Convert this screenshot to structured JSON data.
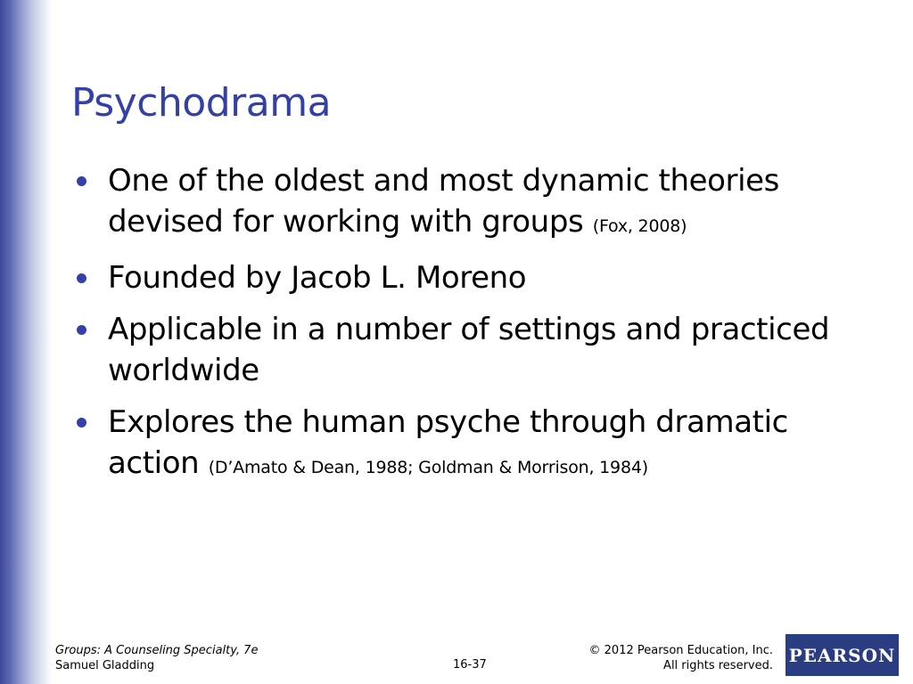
{
  "slide": {
    "title": "Psychodrama",
    "bullets": [
      {
        "text": "One of the oldest and most dynamic theories devised for working with groups",
        "citation": "(Fox, 2008)"
      },
      {
        "text": "Founded by Jacob L. Moreno",
        "citation": ""
      },
      {
        "text": "Applicable in a number of settings and practiced worldwide",
        "citation": ""
      },
      {
        "text": "Explores the human psyche through dramatic action",
        "citation": "(D’Amato & Dean, 1988; Goldman & Morrison, 1984)"
      }
    ]
  },
  "footer": {
    "book_title": "Groups: A Counseling Specialty, 7e",
    "author": "Samuel Gladding",
    "page_number": "16-37",
    "copyright": "© 2012 Pearson Education, Inc.",
    "rights": "All rights reserved.",
    "logo_text": "PEARSON"
  },
  "colors": {
    "accent": "#3340a6",
    "logo_bg": "#2a3d82"
  }
}
